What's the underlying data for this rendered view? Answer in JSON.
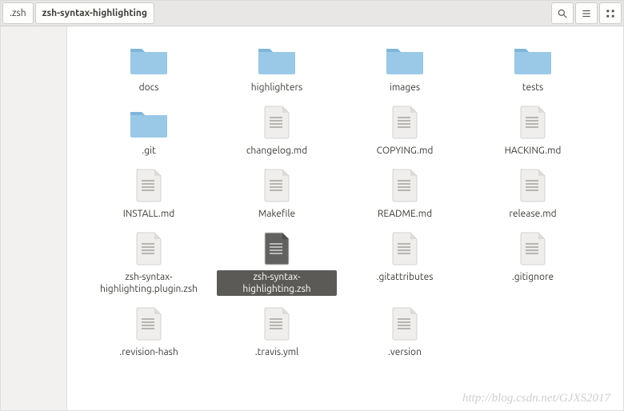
{
  "breadcrumbs": [
    {
      "label": ".zsh",
      "active": false
    },
    {
      "label": "zsh-syntax-highlighting",
      "active": true
    }
  ],
  "toolbar": {
    "search": "search-icon",
    "view_list": "list-view-icon",
    "view_icons": "icon-view-icon"
  },
  "colors": {
    "folder": "#9ac8e7",
    "folder_shadow": "#7fb5da",
    "doc": "#efeeec",
    "doc_lines": "#a8a7a4",
    "doc_fold": "#dcdbd8",
    "selected_bg": "#5b5a57"
  },
  "items": [
    {
      "name": "docs",
      "type": "folder",
      "selected": false
    },
    {
      "name": "highlighters",
      "type": "folder",
      "selected": false
    },
    {
      "name": "images",
      "type": "folder",
      "selected": false
    },
    {
      "name": "tests",
      "type": "folder",
      "selected": false
    },
    {
      "name": ".git",
      "type": "folder",
      "selected": false
    },
    {
      "name": "changelog.md",
      "type": "file",
      "selected": false
    },
    {
      "name": "COPYING.md",
      "type": "file",
      "selected": false
    },
    {
      "name": "HACKING.md",
      "type": "file",
      "selected": false
    },
    {
      "name": "INSTALL.md",
      "type": "file",
      "selected": false
    },
    {
      "name": "Makefile",
      "type": "file",
      "selected": false
    },
    {
      "name": "README.md",
      "type": "file",
      "selected": false
    },
    {
      "name": "release.md",
      "type": "file",
      "selected": false
    },
    {
      "name": "zsh-syntax-highlighting.plugin.zsh",
      "type": "file",
      "selected": false
    },
    {
      "name": "zsh-syntax-highlighting.zsh",
      "type": "file",
      "selected": true
    },
    {
      "name": ".gitattributes",
      "type": "file",
      "selected": false
    },
    {
      "name": ".gitignore",
      "type": "file",
      "selected": false
    },
    {
      "name": ".revision-hash",
      "type": "file",
      "selected": false
    },
    {
      "name": ".travis.yml",
      "type": "file",
      "selected": false
    },
    {
      "name": ".version",
      "type": "file",
      "selected": false
    }
  ],
  "watermark": "http://blog.csdn.net/GJXS2017"
}
